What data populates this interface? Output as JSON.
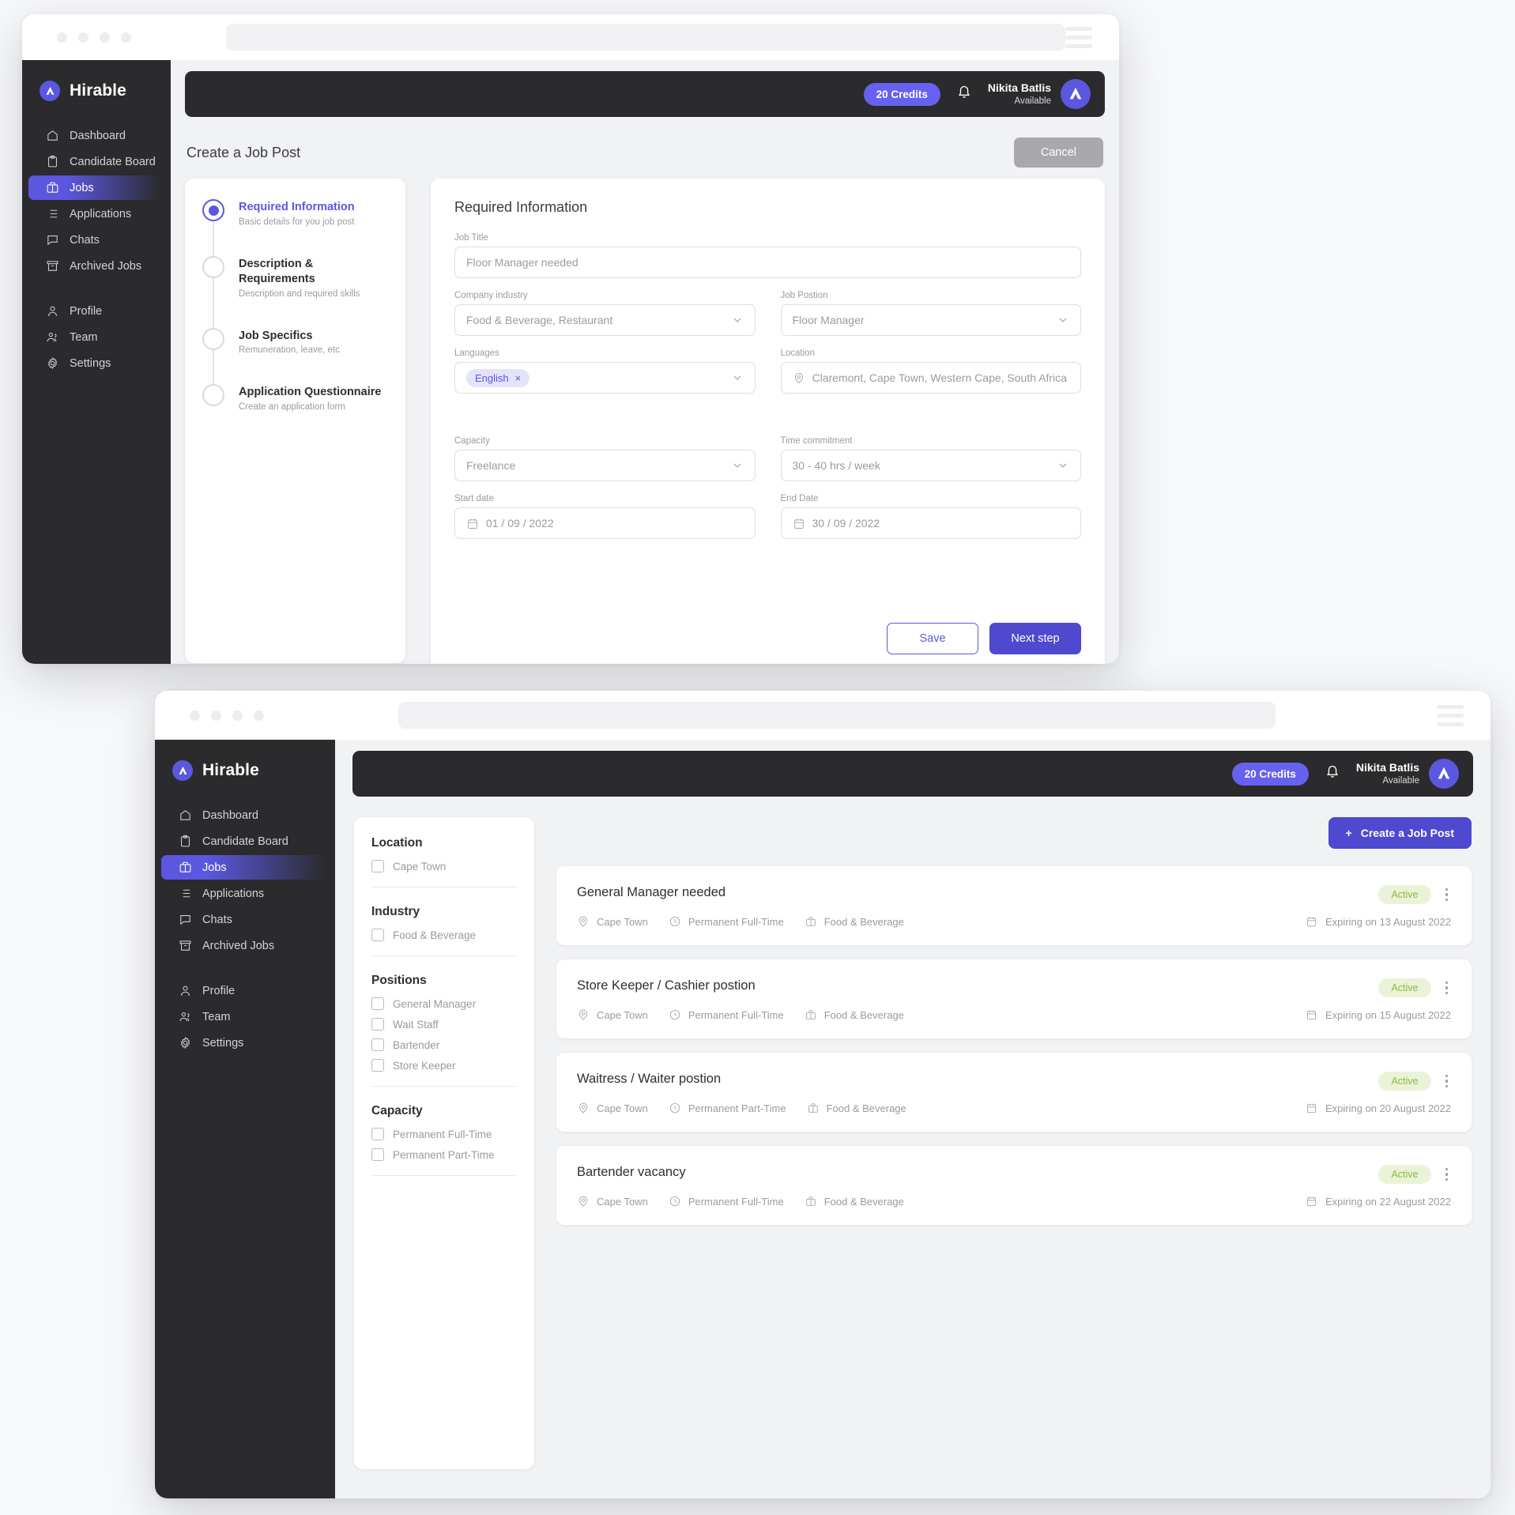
{
  "brand": {
    "name": "Hirable",
    "logo_icon": "hirable-logo-icon"
  },
  "nav": {
    "primary": [
      {
        "label": "Dashboard",
        "icon": "home-icon",
        "active": false
      },
      {
        "label": "Candidate Board",
        "icon": "clipboard-icon",
        "active": false
      },
      {
        "label": "Jobs",
        "icon": "briefcase-icon",
        "active": true
      },
      {
        "label": "Applications",
        "icon": "list-icon",
        "active": false
      },
      {
        "label": "Chats",
        "icon": "chat-icon",
        "active": false
      },
      {
        "label": "Archived Jobs",
        "icon": "archive-icon",
        "active": false
      }
    ],
    "secondary": [
      {
        "label": "Profile",
        "icon": "user-icon",
        "active": false
      },
      {
        "label": "Team",
        "icon": "users-icon",
        "active": false
      },
      {
        "label": "Settings",
        "icon": "gear-icon",
        "active": false
      }
    ]
  },
  "topbar": {
    "credits_label": "20 Credits",
    "bell_icon": "bell-icon",
    "user_name": "Nikita Batlis",
    "user_status": "Available",
    "avatar_icon": "hirable-logo-icon",
    "credits_bg": "#6761ef"
  },
  "window_one": {
    "page_title": "Create a Job Post",
    "cancel_label": "Cancel",
    "stepper": [
      {
        "title": "Required Information",
        "subtitle": "Basic details for you job post",
        "active": true
      },
      {
        "title": "Description & Requirements",
        "subtitle": "Description and required skills",
        "active": false
      },
      {
        "title": "Job Specifics",
        "subtitle": "Remuneration, leave, etc",
        "active": false
      },
      {
        "title": "Application Questionnaire",
        "subtitle": "Create an application form",
        "active": false
      }
    ],
    "form": {
      "heading": "Required Information",
      "job_title": {
        "label": "Job Title",
        "value": "Floor Manager needed"
      },
      "company_industry": {
        "label": "Company industry",
        "value": "Food & Beverage, Restaurant"
      },
      "job_position": {
        "label": "Job Postion",
        "value": "Floor Manager"
      },
      "languages": {
        "label": "Languages",
        "tags": [
          "English"
        ],
        "tag_remove": "×"
      },
      "location": {
        "label": "Location",
        "value": "Claremont, Cape Town, Western Cape, South Africa",
        "icon": "map-pin-icon"
      },
      "capacity": {
        "label": "Capacity",
        "value": "Freelance"
      },
      "time_commitment": {
        "label": "Time commitment",
        "value": "30 - 40 hrs / week"
      },
      "start_date": {
        "label": "Start date",
        "value": "01 / 09 / 2022",
        "icon": "calendar-icon"
      },
      "end_date": {
        "label": "End Date",
        "value": "30 / 09 / 2022",
        "icon": "calendar-icon"
      },
      "save_label": "Save",
      "next_label": "Next step"
    }
  },
  "window_two": {
    "create_button": {
      "label": "Create a Job Post",
      "icon": "plus-icon"
    },
    "filters": [
      {
        "title": "Location",
        "options": [
          "Cape Town"
        ]
      },
      {
        "title": "Industry",
        "options": [
          "Food & Beverage"
        ]
      },
      {
        "title": "Positions",
        "options": [
          "General Manager",
          "Wait Staff",
          "Bartender",
          "Store Keeper"
        ]
      },
      {
        "title": "Capacity",
        "options": [
          "Permanent Full-Time",
          "Permanent Part-Time"
        ]
      }
    ],
    "jobs": [
      {
        "title": "General Manager needed",
        "location": "Cape Town",
        "capacity": "Permanent Full-Time",
        "industry": "Food & Beverage",
        "status": "Active",
        "expiry": "Expiring on 13 August 2022"
      },
      {
        "title": "Store Keeper / Cashier postion",
        "location": "Cape Town",
        "capacity": "Permanent Full-Time",
        "industry": "Food & Beverage",
        "status": "Active",
        "expiry": "Expiring on 15 August 2022"
      },
      {
        "title": "Waitress / Waiter postion",
        "location": "Cape Town",
        "capacity": "Permanent Part-Time",
        "industry": "Food & Beverage",
        "status": "Active",
        "expiry": "Expiring on 20 August 2022"
      },
      {
        "title": "Bartender vacancy",
        "location": "Cape Town",
        "capacity": "Permanent Full-Time",
        "industry": "Food & Beverage",
        "status": "Active",
        "expiry": "Expiring on 22 August 2022"
      }
    ]
  },
  "colors": {
    "accent": "#5b57df",
    "accent_dark": "#4e49cf",
    "sidebar_bg": "#2b2b2d",
    "badge_bg": "#eaf3d7",
    "badge_text": "#8aba3f"
  }
}
